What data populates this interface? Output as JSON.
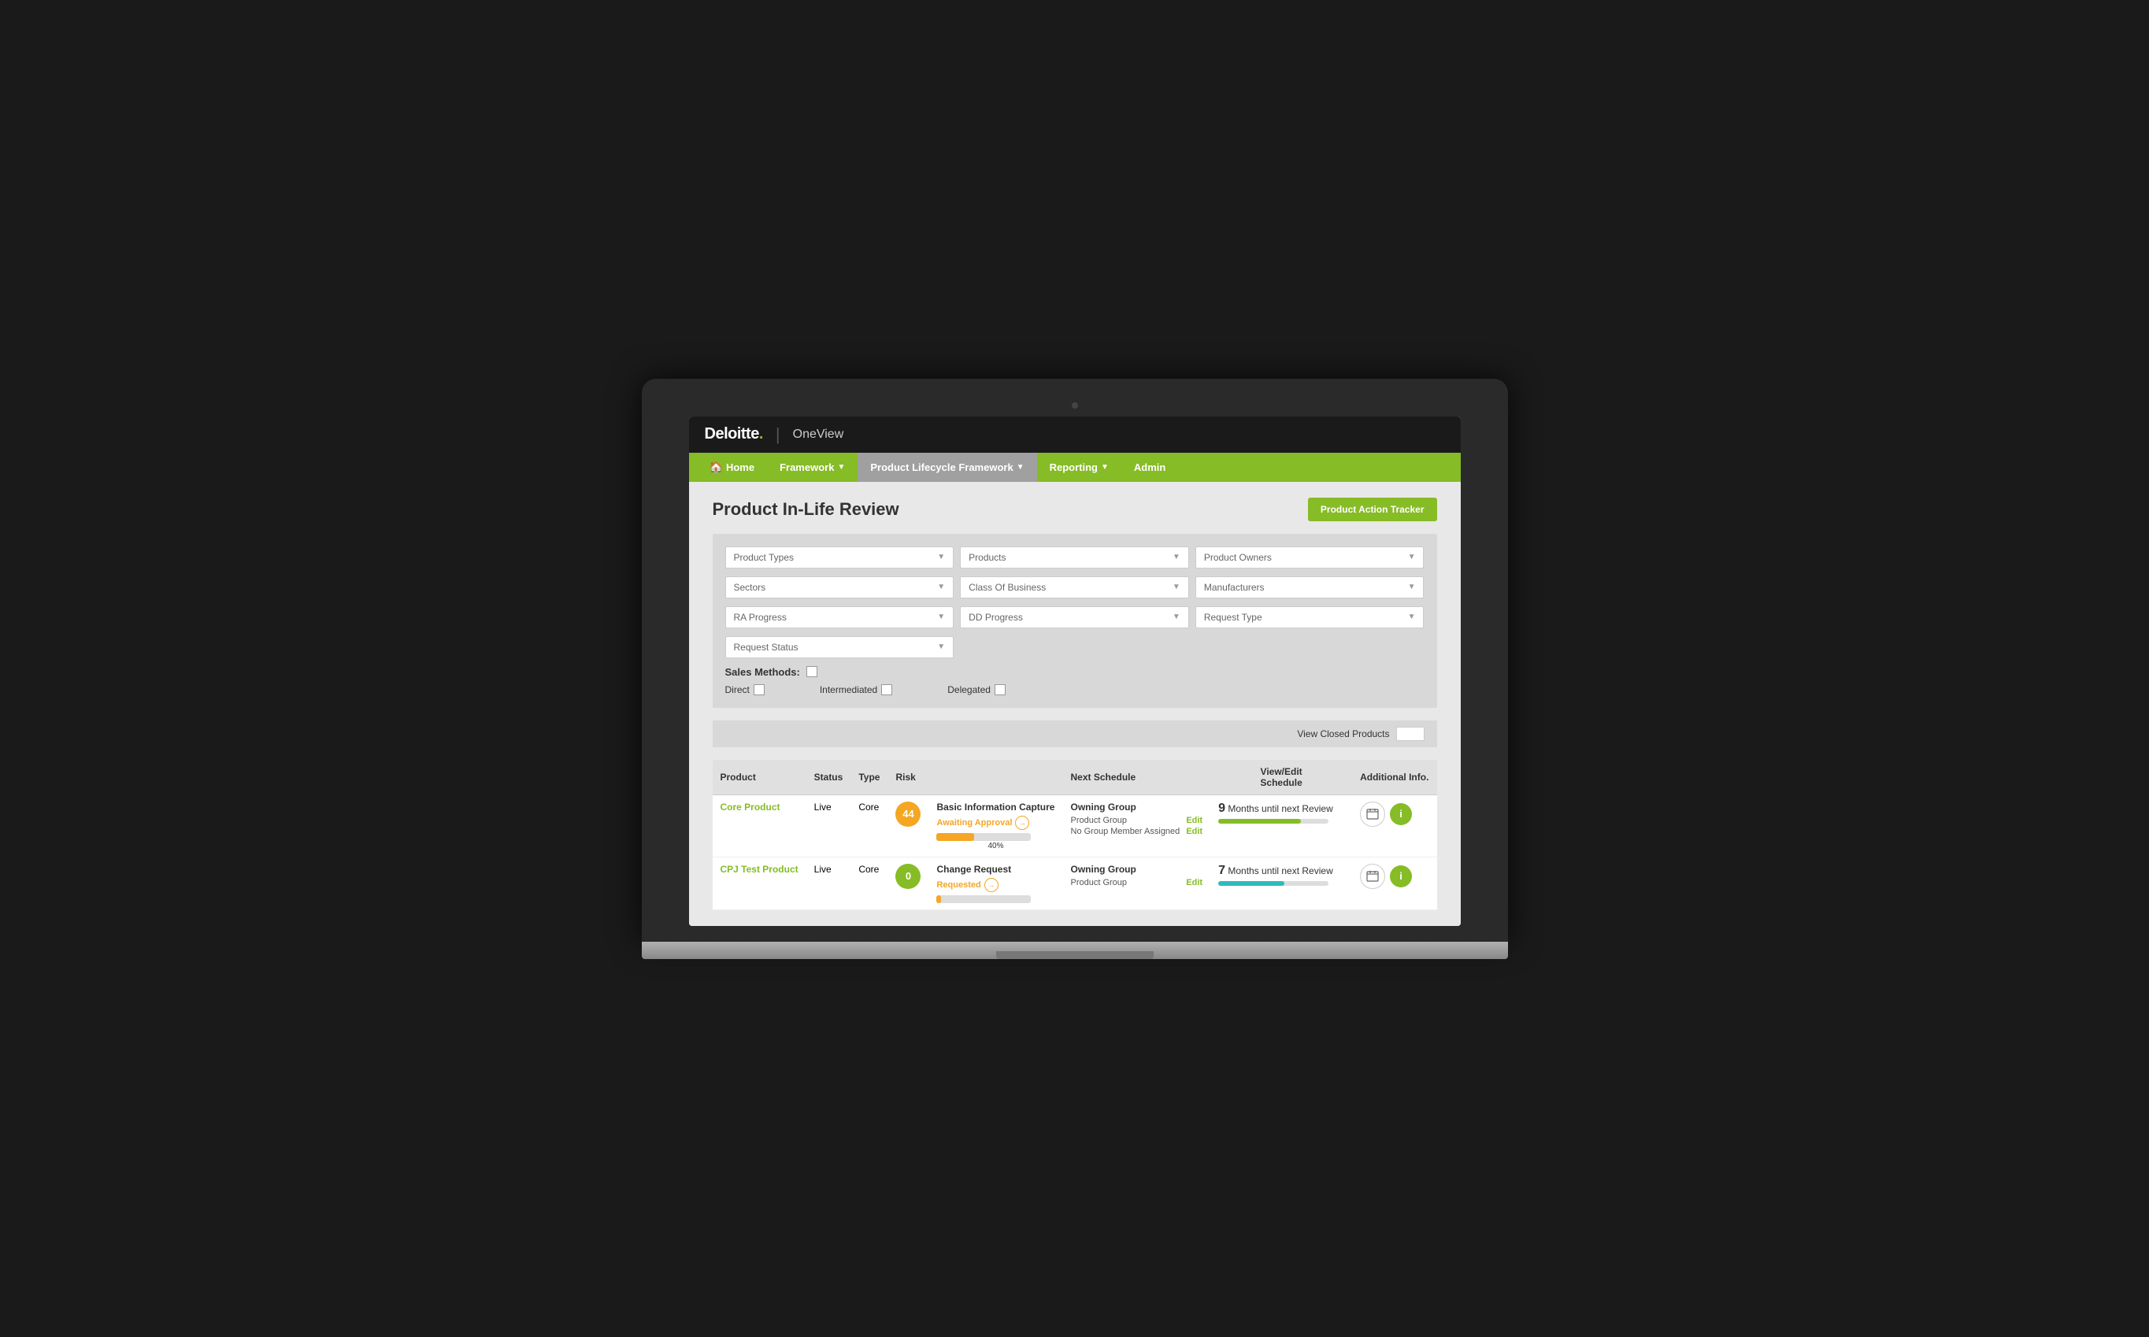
{
  "app": {
    "brand": "Deloitte",
    "brand_dot": ".",
    "divider": "|",
    "product_name": "OneView"
  },
  "nav": {
    "items": [
      {
        "id": "home",
        "label": "Home",
        "icon": "🏠",
        "active": false
      },
      {
        "id": "framework",
        "label": "Framework",
        "has_arrow": true,
        "active": false
      },
      {
        "id": "product-lifecycle",
        "label": "Product Lifecycle Framework",
        "has_arrow": true,
        "active": true
      },
      {
        "id": "reporting",
        "label": "Reporting",
        "has_arrow": true,
        "active": false
      },
      {
        "id": "admin",
        "label": "Admin",
        "active": false
      }
    ]
  },
  "page": {
    "title": "Product In-Life Review",
    "action_tracker_label": "Product Action Tracker"
  },
  "filters": {
    "row1": [
      {
        "id": "product-types",
        "placeholder": "Product Types"
      },
      {
        "id": "products",
        "placeholder": "Products"
      },
      {
        "id": "product-owners",
        "placeholder": "Product Owners"
      }
    ],
    "row2": [
      {
        "id": "sectors",
        "placeholder": "Sectors"
      },
      {
        "id": "class-of-business",
        "placeholder": "Class Of Business"
      },
      {
        "id": "manufacturers",
        "placeholder": "Manufacturers"
      }
    ],
    "row3": [
      {
        "id": "ra-progress",
        "placeholder": "RA Progress"
      },
      {
        "id": "dd-progress",
        "placeholder": "DD Progress"
      },
      {
        "id": "request-type",
        "placeholder": "Request Type"
      }
    ],
    "row4": [
      {
        "id": "request-status",
        "placeholder": "Request Status"
      }
    ]
  },
  "sales_methods": {
    "label": "Sales Methods:",
    "items": [
      {
        "id": "direct",
        "label": "Direct"
      },
      {
        "id": "intermediated",
        "label": "Intermediated"
      },
      {
        "id": "delegated",
        "label": "Delegated"
      }
    ]
  },
  "toggle": {
    "label": "View Closed Products"
  },
  "table": {
    "headers": [
      "Product",
      "Status",
      "Type",
      "Risk",
      "",
      "Next Schedule",
      "View/Edit Schedule",
      "Additional Info."
    ],
    "rows": [
      {
        "id": "row-1",
        "product_name": "Core Product",
        "status": "Live",
        "type": "Core",
        "risk": "44",
        "risk_color": "orange",
        "progress_title": "Basic Information Capture",
        "progress_status": "Awaiting Approval",
        "progress_pct": "40%",
        "progress_fill": 40,
        "owning_group_title": "Owning Group",
        "owning_group_value": "Product Group",
        "no_group_member": "No Group Member Assigned",
        "schedule_months": "9",
        "schedule_label": "Months until next Review",
        "schedule_fill": 75,
        "schedule_color": "green"
      },
      {
        "id": "row-2",
        "product_name": "CPJ Test Product",
        "status": "Live",
        "type": "Core",
        "risk": "0",
        "risk_color": "green",
        "progress_title": "Change Request",
        "progress_status": "Requested",
        "progress_pct": "",
        "progress_fill": 0,
        "owning_group_title": "Owning Group",
        "owning_group_value": "Product Group",
        "no_group_member": "",
        "schedule_months": "7",
        "schedule_label": "Months until next Review",
        "schedule_fill": 60,
        "schedule_color": "teal"
      }
    ],
    "edit_label": "Edit"
  }
}
